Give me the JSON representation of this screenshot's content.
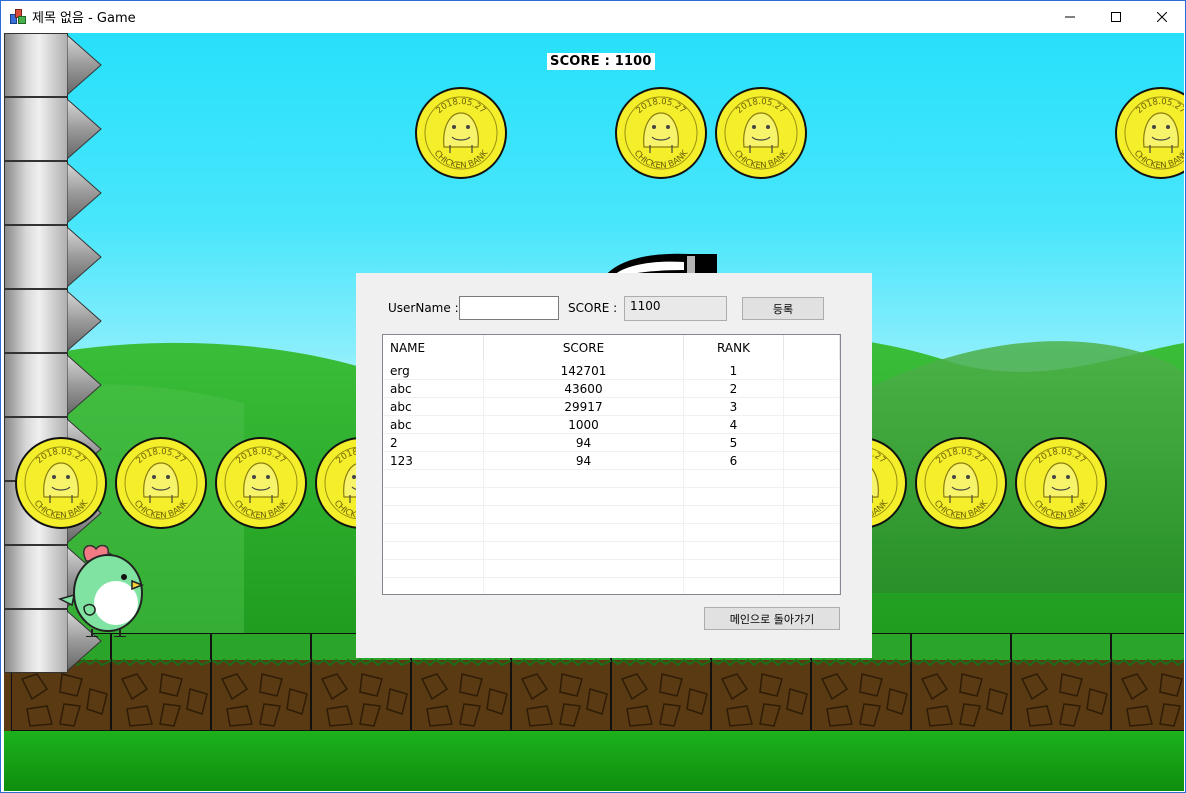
{
  "window": {
    "title": "제목 없음 - Game"
  },
  "game": {
    "score_text": "SCORE : 1100",
    "coin_text_top": "2018.05.27",
    "coin_text_bottom": "CHICKEN BANK"
  },
  "dialog": {
    "username_label": "UserName :",
    "username_value": "",
    "score_label": "SCORE :",
    "score_value": "1100",
    "register_button": "등록",
    "back_button": "메인으로 돌아가기",
    "columns": [
      "NAME",
      "SCORE",
      "RANK"
    ],
    "rows": [
      {
        "name": "erg",
        "score": "142701",
        "rank": "1"
      },
      {
        "name": "abc",
        "score": "43600",
        "rank": "2"
      },
      {
        "name": "abc",
        "score": "29917",
        "rank": "3"
      },
      {
        "name": "abc",
        "score": "1000",
        "rank": "4"
      },
      {
        "name": "2",
        "score": "94",
        "rank": "5"
      },
      {
        "name": "123",
        "score": "94",
        "rank": "6"
      }
    ]
  },
  "colors": {
    "coin": "#f4ef2a",
    "sky": "#27e0fb",
    "grass": "#1cb21c"
  }
}
